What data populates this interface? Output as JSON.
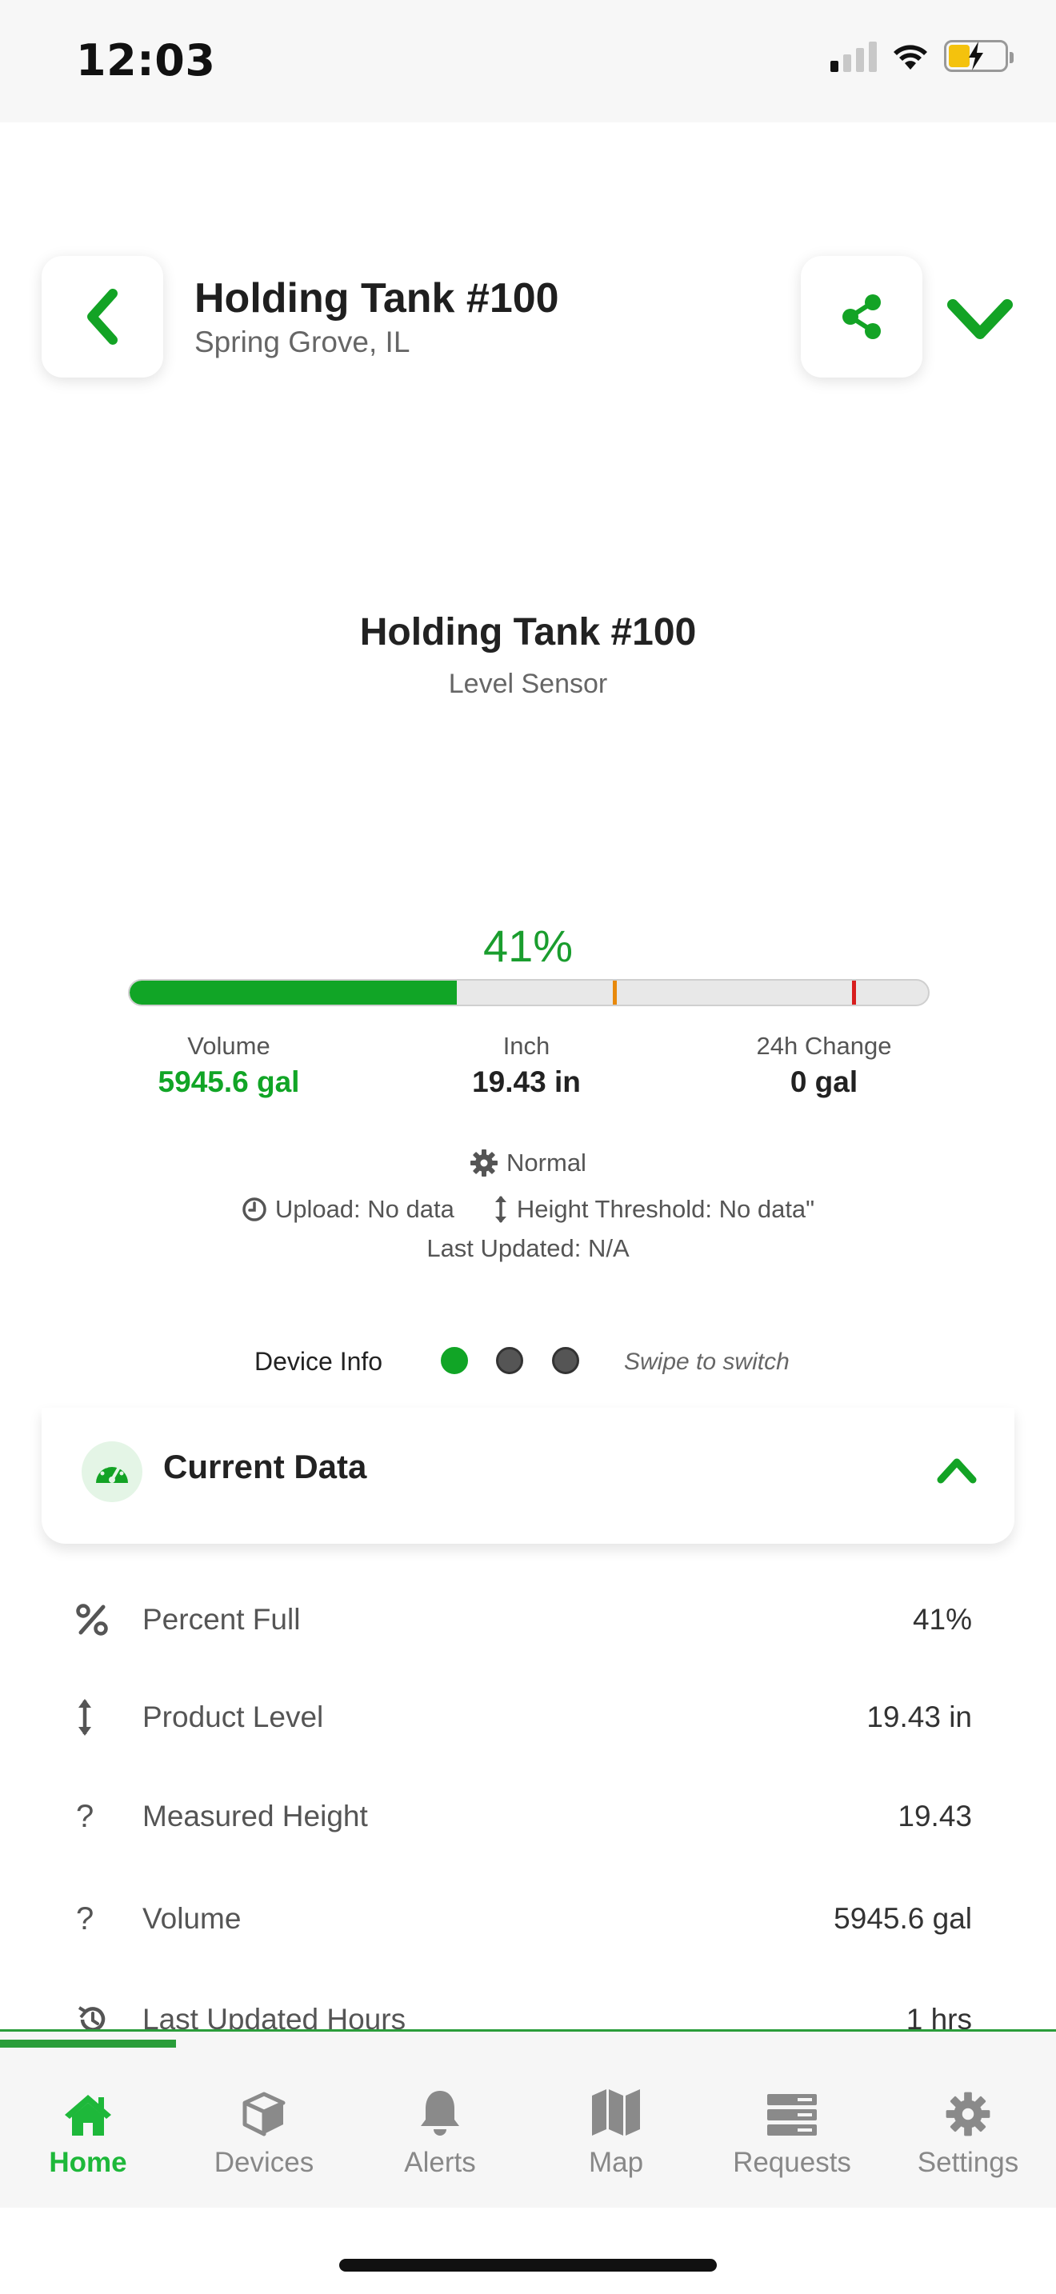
{
  "status_bar": {
    "time": "12:03",
    "signal_bars": 4,
    "signal_active": 1,
    "battery_level": 0.38
  },
  "header": {
    "title": "Holding Tank #100",
    "subtitle": "Spring Grove, IL",
    "back_icon": "chevron-left-icon",
    "share_icon": "share-icon",
    "menu_icon": "chevron-down-icon"
  },
  "device": {
    "name": "Holding Tank #100",
    "type": "Level Sensor"
  },
  "level": {
    "percent_label": "41%",
    "percent_value": 41,
    "thresholds": [
      {
        "value": 60.5,
        "color": "#e8890c"
      },
      {
        "value": 90.5,
        "color": "#d81e1e"
      }
    ],
    "fill_color": "#11a526"
  },
  "stats": {
    "volume": {
      "label": "Volume",
      "value": "5945.6 gal"
    },
    "inch": {
      "label": "Inch",
      "value": "19.43 in"
    },
    "change": {
      "label": "24h Change",
      "value": "0 gal"
    }
  },
  "status": {
    "mode": "Normal",
    "upload": "Upload: No data",
    "height_threshold": "Height Threshold: No data\"",
    "last_updated": "Last Updated: N/A"
  },
  "device_info": {
    "label": "Device Info",
    "pages": 3,
    "active_page": 0,
    "hint": "Swipe to switch"
  },
  "current_data": {
    "title": "Current Data",
    "rows": [
      {
        "icon": "percent-icon",
        "label": "Percent Full",
        "value": "41%"
      },
      {
        "icon": "vertical-arrows-icon",
        "label": "Product Level",
        "value": "19.43 in"
      },
      {
        "icon": "question-icon",
        "label": "Measured Height",
        "value": "19.43"
      },
      {
        "icon": "question-icon",
        "label": "Volume",
        "value": "5945.6 gal"
      },
      {
        "icon": "history-icon",
        "label": "Last Updated Hours",
        "value": "1 hrs"
      }
    ]
  },
  "tabs": [
    {
      "label": "Home",
      "icon": "home-icon",
      "active": true
    },
    {
      "label": "Devices",
      "icon": "cube-icon",
      "active": false
    },
    {
      "label": "Alerts",
      "icon": "bell-icon",
      "active": false
    },
    {
      "label": "Map",
      "icon": "map-icon",
      "active": false
    },
    {
      "label": "Requests",
      "icon": "server-icon",
      "active": false
    },
    {
      "label": "Settings",
      "icon": "gear-icon",
      "active": false
    }
  ],
  "colors": {
    "brand_green": "#11a526",
    "tab_active": "#1eb83a"
  }
}
